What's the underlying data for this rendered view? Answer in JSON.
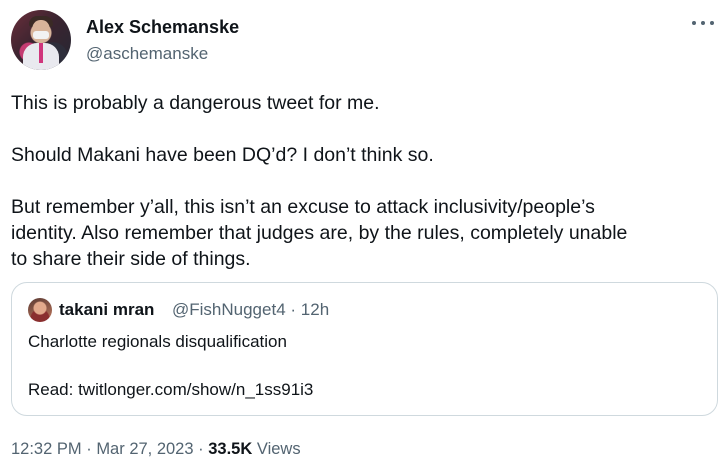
{
  "author": {
    "name": "Alex Schemanske",
    "handle": "@aschemanske",
    "avatar_icon": "profile-photo"
  },
  "menu_icon": "more-horizontal-icon",
  "tweet": {
    "paragraphs": [
      "This is probably a dangerous tweet for me.",
      "Should Makani have been DQ’d? I don’t think so.",
      "But remember y’all, this isn’t an excuse to attack inclusivity/people’s\nidentity. Also remember that judges are, by the rules, completely unable\nto share their side of things."
    ]
  },
  "quote": {
    "name": "takani mran",
    "handle": "@FishNugget4",
    "time": "12h",
    "separator": "·",
    "lines": [
      "Charlotte regionals disqualification",
      "Read: twitlonger.com/show/n_1ss91i3"
    ]
  },
  "footer": {
    "time": "12:32 PM",
    "separator": "·",
    "date": "Mar 27, 2023",
    "views_count": "33.5K",
    "views_label": "Views"
  },
  "colors": {
    "text": "#0f1419",
    "secondary": "#536471",
    "border": "#cfd9de"
  }
}
